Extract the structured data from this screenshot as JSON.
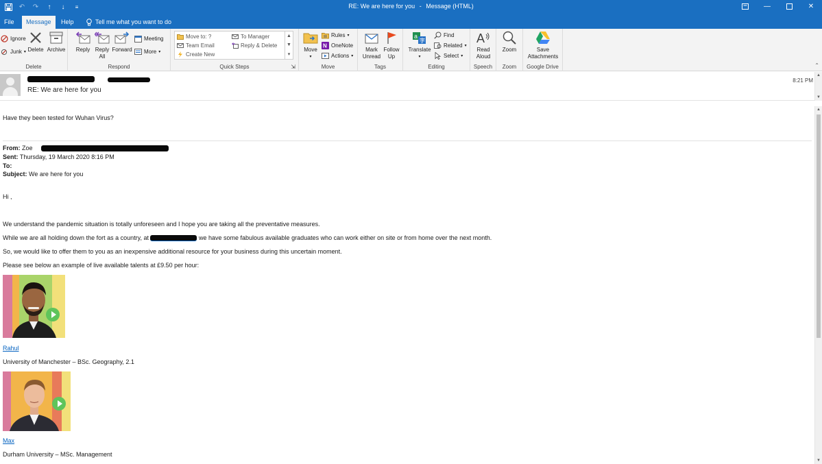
{
  "window": {
    "title": "RE: We are here for you",
    "title_suffix": "Message (HTML)",
    "title_separator": "-"
  },
  "tabs": {
    "file": "File",
    "message": "Message",
    "help": "Help",
    "tell_me": "Tell me what you want to do"
  },
  "ribbon": {
    "delete_group": {
      "label": "Delete",
      "ignore": "Ignore",
      "junk": "Junk",
      "delete": "Delete",
      "archive": "Archive"
    },
    "respond_group": {
      "label": "Respond",
      "reply": "Reply",
      "reply_all_line1": "Reply",
      "reply_all_line2": "All",
      "forward": "Forward",
      "meeting": "Meeting",
      "more": "More"
    },
    "quick_steps_group": {
      "label": "Quick Steps",
      "move_to": "Move to: ?",
      "to_manager": "To Manager",
      "team_email": "Team Email",
      "reply_delete": "Reply & Delete",
      "create_new": "Create New"
    },
    "move_group": {
      "label": "Move",
      "move": "Move",
      "rules": "Rules",
      "onenote": "OneNote",
      "actions": "Actions"
    },
    "tags_group": {
      "label": "Tags",
      "mark_unread_line1": "Mark",
      "mark_unread_line2": "Unread",
      "follow_up_line1": "Follow",
      "follow_up_line2": "Up"
    },
    "editing_group": {
      "label": "Editing",
      "translate": "Translate",
      "find": "Find",
      "related": "Related",
      "select": "Select"
    },
    "speech_group": {
      "label": "Speech",
      "read_aloud_line1": "Read",
      "read_aloud_line2": "Aloud"
    },
    "zoom_group": {
      "label": "Zoom",
      "zoom": "Zoom"
    },
    "gdrive_group": {
      "label": "Google Drive",
      "save_line1": "Save",
      "save_line2": "Attachments"
    }
  },
  "message": {
    "subject": "RE: We are here for you",
    "time": "8:21 PM",
    "reply_text": "Have they been tested for Wuhan Virus?",
    "quoted": {
      "from_label": "From:",
      "from_value": "Zoe",
      "sent_label": "Sent:",
      "sent_value": "Thursday, 19 March 2020 8:16 PM",
      "to_label": "To:",
      "subject_label": "Subject:",
      "subject_value": "We are here for you"
    },
    "greeting": "Hi ,",
    "para1": "We understand the pandemic situation is totally unforeseen and I hope you are taking all the preventative measures.",
    "para2_before": "While we are all holding down the fort as a country, at",
    "para2_after": "we have some fabulous available graduates who can work either on site or from home over the next month.",
    "para3": "So, we would like to offer them to you as an inexpensive additional resource for your business during this uncertain moment.",
    "para4": "Please see below an example of live available talents at £9.50 per hour:",
    "candidates": [
      {
        "name": "Rahul",
        "education": "University of Manchester – BSc. Geography, 2.1"
      },
      {
        "name": "Max",
        "education": "Durham University – MSc. Management"
      }
    ]
  },
  "colors": {
    "title_bar": "#1a6fc1",
    "ribbon_bg": "#f3f3f3",
    "link": "#0563c1",
    "play_button": "#5fc45b"
  }
}
